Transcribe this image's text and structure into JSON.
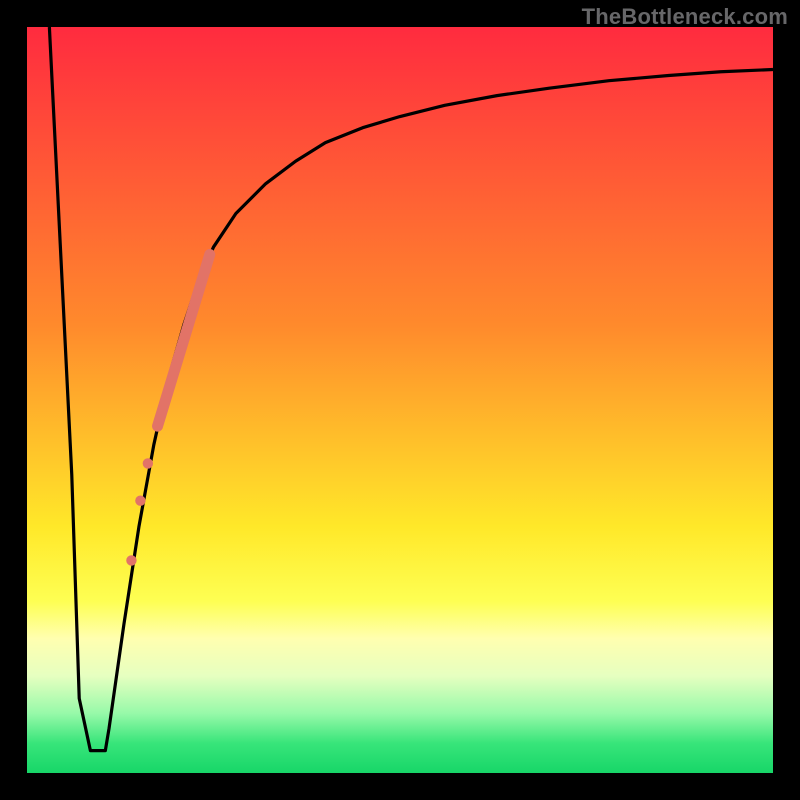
{
  "watermark": "TheBottleneck.com",
  "chart_data": {
    "type": "line",
    "title": "",
    "xlabel": "",
    "ylabel": "",
    "xlim": [
      0,
      100
    ],
    "ylim": [
      0,
      100
    ],
    "background_gradient": {
      "stops": [
        {
          "offset": 0,
          "color": "#ff2b3f"
        },
        {
          "offset": 40,
          "color": "#ff8a2c"
        },
        {
          "offset": 67,
          "color": "#ffe829"
        },
        {
          "offset": 77,
          "color": "#feff53"
        },
        {
          "offset": 82,
          "color": "#ffffb0"
        },
        {
          "offset": 87,
          "color": "#e6ffc0"
        },
        {
          "offset": 92,
          "color": "#97f9a9"
        },
        {
          "offset": 96,
          "color": "#38e57a"
        },
        {
          "offset": 100,
          "color": "#17d668"
        }
      ]
    },
    "series": [
      {
        "name": "bottleneck-curve",
        "x": [
          3,
          6,
          7,
          8.5,
          9,
          9.5,
          10.5,
          11,
          13,
          15,
          17,
          19,
          21,
          23,
          25,
          28,
          32,
          36,
          40,
          45,
          50,
          56,
          63,
          70,
          78,
          86,
          93,
          100
        ],
        "y": [
          100,
          40,
          10,
          3,
          3,
          3,
          3,
          6,
          20,
          33,
          44,
          53,
          60,
          66,
          70.5,
          75,
          79,
          82,
          84.5,
          86.5,
          88,
          89.5,
          90.8,
          91.8,
          92.8,
          93.5,
          94,
          94.3
        ]
      }
    ],
    "markers": [
      {
        "name": "segment-thick",
        "type": "line",
        "x1": 17.5,
        "y1": 46.5,
        "x2": 24.5,
        "y2": 69.5,
        "color": "#e27367",
        "width": 11
      },
      {
        "name": "dot-1",
        "type": "dot",
        "x": 16.2,
        "y": 41.5,
        "r": 5.2,
        "color": "#e27367"
      },
      {
        "name": "dot-2",
        "type": "dot",
        "x": 15.2,
        "y": 36.5,
        "r": 5.2,
        "color": "#e27367"
      },
      {
        "name": "dot-3",
        "type": "dot",
        "x": 14.0,
        "y": 28.5,
        "r": 5.2,
        "color": "#e27367"
      }
    ]
  }
}
